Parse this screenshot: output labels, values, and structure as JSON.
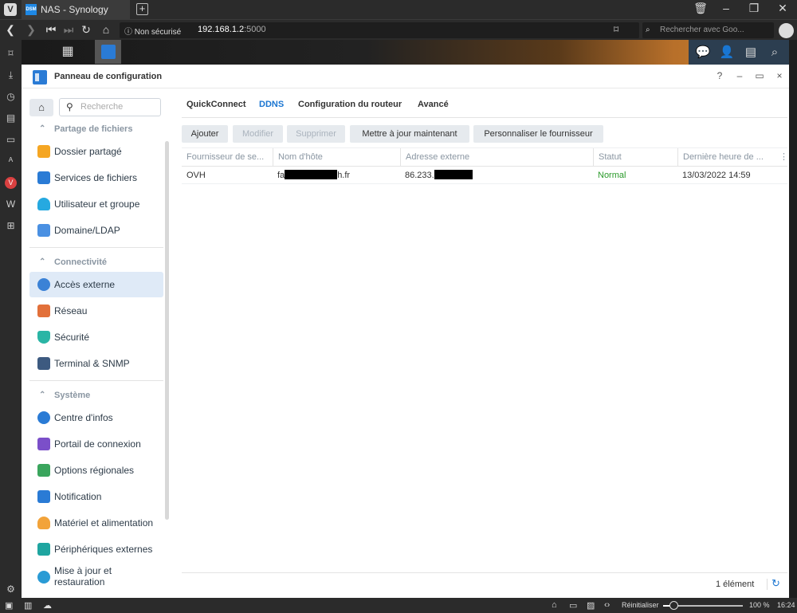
{
  "browser": {
    "tab_title": "NAS - Synology NAS",
    "tab_favicon": "DSM",
    "security_label": "Non sécurisé",
    "url_host": "192.168.1.2",
    "url_port": ":5000",
    "search_placeholder": "Rechercher avec Goo..."
  },
  "window": {
    "title": "Panneau de configuration",
    "help": "?",
    "minimize": "–",
    "restore": "▭",
    "close": "×"
  },
  "nav": {
    "search_placeholder": "Recherche",
    "sections": [
      {
        "label": "Partage de fichiers",
        "items": [
          {
            "label": "Dossier partagé",
            "icon": "folder-icon",
            "color": "#f5a623"
          },
          {
            "label": "Services de fichiers",
            "icon": "file-services-icon",
            "color": "#2a7bd5"
          },
          {
            "label": "Utilisateur et groupe",
            "icon": "users-icon",
            "color": "#26a9e0"
          },
          {
            "label": "Domaine/LDAP",
            "icon": "domain-icon",
            "color": "#4a90e2"
          }
        ]
      },
      {
        "label": "Connectivité",
        "items": [
          {
            "label": "Accès externe",
            "icon": "external-access-icon",
            "color": "#3b82d6",
            "active": true
          },
          {
            "label": "Réseau",
            "icon": "network-house-icon",
            "color": "#e2703a"
          },
          {
            "label": "Sécurité",
            "icon": "shield-icon",
            "color": "#2ab5a5"
          },
          {
            "label": "Terminal & SNMP",
            "icon": "terminal-icon",
            "color": "#3d5a80"
          }
        ]
      },
      {
        "label": "Système",
        "items": [
          {
            "label": "Centre d'infos",
            "icon": "info-icon",
            "color": "#2a7bd5"
          },
          {
            "label": "Portail de connexion",
            "icon": "login-portal-icon",
            "color": "#7b4fc9"
          },
          {
            "label": "Options régionales",
            "icon": "regional-options-icon",
            "color": "#3aa55d"
          },
          {
            "label": "Notification",
            "icon": "notification-icon",
            "color": "#2a7bd5"
          },
          {
            "label": "Matériel et alimentation",
            "icon": "lightbulb-icon",
            "color": "#f2a33a"
          },
          {
            "label": "Périphériques externes",
            "icon": "external-devices-icon",
            "color": "#1fa5a0"
          },
          {
            "label": "Mise à jour et restauration",
            "icon": "update-icon",
            "color": "#2a9bd5"
          }
        ]
      }
    ]
  },
  "tabs": [
    "QuickConnect",
    "DDNS",
    "Configuration du routeur",
    "Avancé"
  ],
  "active_tab": "DDNS",
  "toolbar": {
    "add": "Ajouter",
    "edit": "Modifier",
    "delete": "Supprimer",
    "update_now": "Mettre à jour maintenant",
    "customize_provider": "Personnaliser le fournisseur"
  },
  "grid": {
    "columns": [
      "Fournisseur de se...",
      "Nom d'hôte",
      "Adresse externe",
      "Statut",
      "Dernière heure de ..."
    ],
    "rows": [
      {
        "provider": "OVH",
        "hostname_prefix": "fa",
        "hostname_suffix": "h.fr",
        "external_address": "86.233.",
        "status": "Normal",
        "last_update": "13/03/2022 14:59"
      }
    ],
    "count": "1 élément"
  },
  "statusbar": {
    "reset_label": "Réinitialiser",
    "zoom": "100 %",
    "zoom_level": 0.13,
    "time": "16:24"
  }
}
